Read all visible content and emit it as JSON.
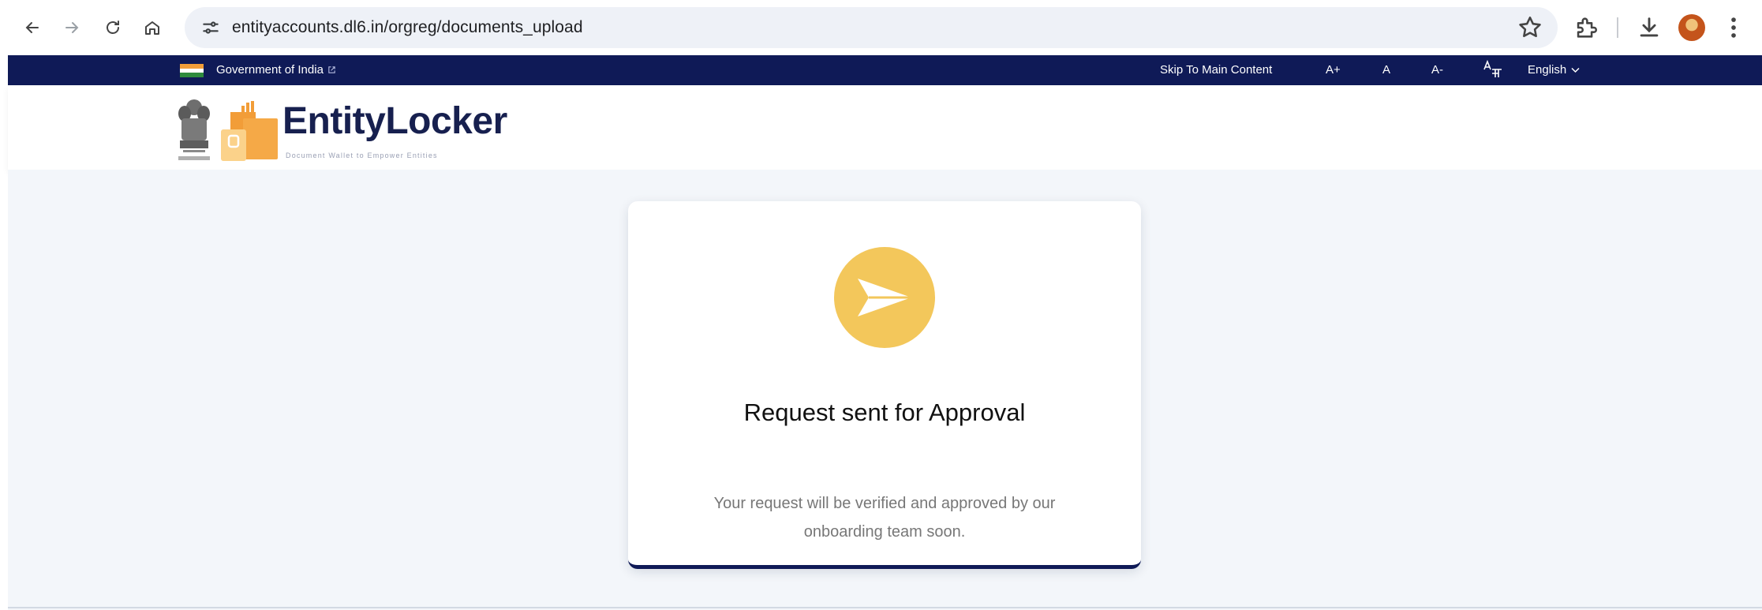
{
  "browser": {
    "url": "entityaccounts.dl6.in/orgreg/documents_upload"
  },
  "gov_bar": {
    "government": "Government of India",
    "skip_link": "Skip To Main Content",
    "font_increase": "A+",
    "font_normal": "A",
    "font_decrease": "A-",
    "language": "English"
  },
  "header": {
    "brand": "EntityLocker",
    "tagline": "Document Wallet to Empower Entities"
  },
  "card": {
    "title": "Request sent for Approval",
    "message_line1": "Your request will be verified and approved by our",
    "message_line2": "onboarding team soon."
  },
  "colors": {
    "gov_bar": "#0f1a57",
    "brand_orange": "#f29d38",
    "accent_yellow": "#f3c75b",
    "page_bg": "#f3f6fa"
  }
}
